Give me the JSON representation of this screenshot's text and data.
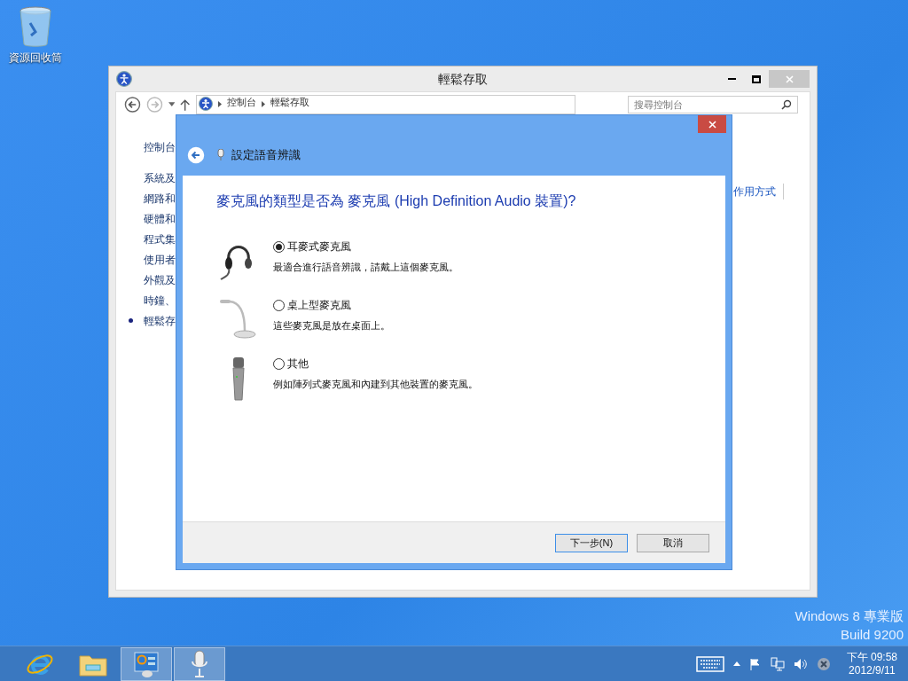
{
  "desktop_icons": [
    {
      "label": "資源回收筒"
    }
  ],
  "control_panel": {
    "title": "輕鬆存取",
    "breadcrumb": [
      "控制台",
      "輕鬆存取"
    ],
    "search": {
      "placeholder": "搜尋控制台"
    },
    "sidebar": [
      {
        "label": "控制台",
        "selected": false
      },
      {
        "label": "系統及",
        "selected": false
      },
      {
        "label": "網路和",
        "selected": false
      },
      {
        "label": "硬體和",
        "selected": false
      },
      {
        "label": "程式集",
        "selected": false
      },
      {
        "label": "使用者",
        "selected": false
      },
      {
        "label": "外觀及",
        "selected": false
      },
      {
        "label": "時鐘、",
        "selected": false
      },
      {
        "label": "輕鬆存",
        "selected": true
      }
    ],
    "right_link": "作用方式"
  },
  "dialog": {
    "title": "設定語音辨識",
    "question": "麥克風的類型是否為 麥克風 (High Definition Audio 裝置)?",
    "options": [
      {
        "kind": "headset",
        "label": "耳麥式麥克風",
        "description": "最適合進行語音辨識，請戴上這個麥克風。",
        "selected": true
      },
      {
        "kind": "desktop",
        "label": "桌上型麥克風",
        "description": "這些麥克風是放在桌面上。",
        "selected": false
      },
      {
        "kind": "handheld",
        "label": "其他",
        "description": "例如陣列式麥克風和內建到其他裝置的麥克風。",
        "selected": false
      }
    ],
    "buttons": [
      {
        "label": "下一步(N)",
        "default": true
      },
      {
        "label": "取消",
        "default": false
      }
    ]
  },
  "edition": [
    "Windows 8 專業版",
    "Build 9200"
  ],
  "taskbar": {
    "apps": [
      {
        "kind": "browser",
        "active": false
      },
      {
        "kind": "folder",
        "active": false
      },
      {
        "kind": "control-panel",
        "active": true
      },
      {
        "kind": "microphone",
        "active": true
      }
    ],
    "time": "下午 09:58",
    "date": "2012/9/11"
  }
}
